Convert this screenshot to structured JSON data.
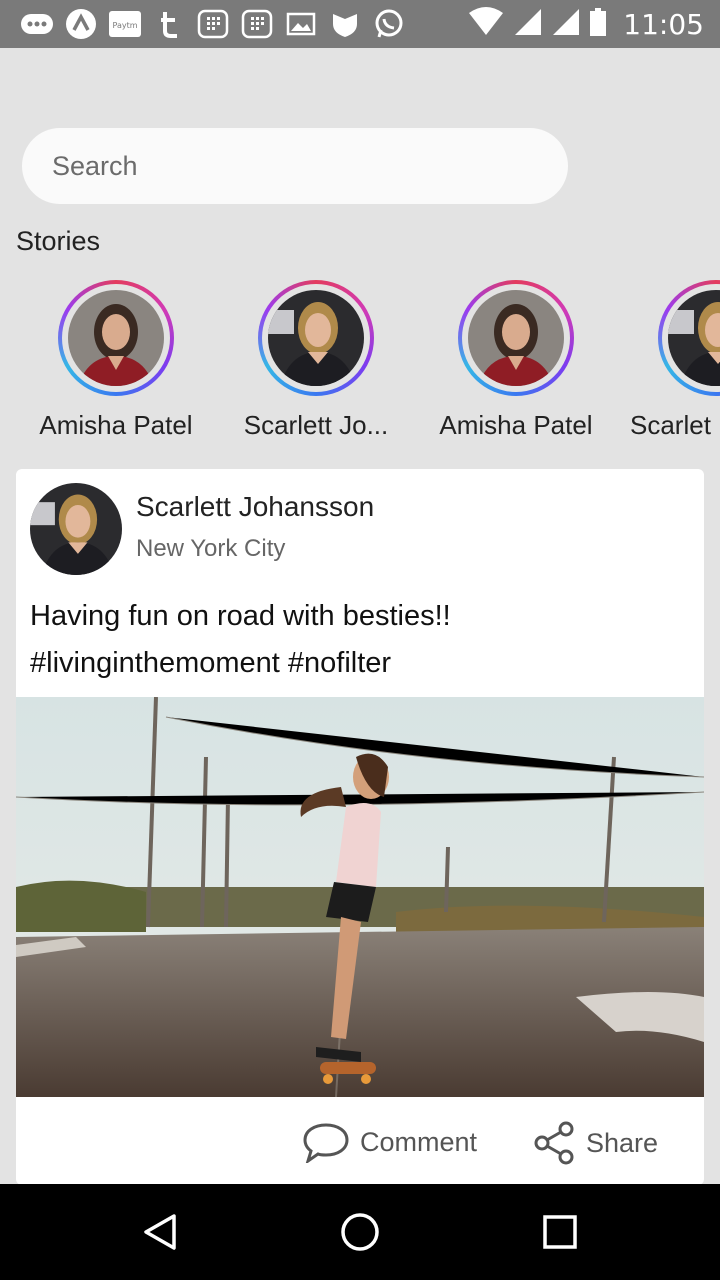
{
  "status_bar": {
    "time": "11:05",
    "left_icons": [
      "more-icon",
      "app-a-icon",
      "paytm-icon",
      "tumblr-icon",
      "calculator-icon",
      "calculator-icon",
      "image-icon",
      "shield-icon",
      "whatsapp-icon"
    ],
    "right_icons": [
      "wifi-icon",
      "signal-icon",
      "signal-icon",
      "battery-icon"
    ],
    "paytm_text": "Paytm"
  },
  "search": {
    "placeholder": "Search"
  },
  "stories": {
    "title": "Stories",
    "items": [
      {
        "name": "Amisha Patel"
      },
      {
        "name": "Scarlett Jo..."
      },
      {
        "name": "Amisha Patel"
      },
      {
        "name": "Scarlet"
      }
    ]
  },
  "post": {
    "author": "Scarlett Johansson",
    "location": "New York City",
    "text_line1": "Having fun on road with besties!!",
    "text_line2": "#livinginthemoment #nofilter",
    "actions": {
      "comment": "Comment",
      "share": "Share"
    }
  },
  "colors": {
    "background": "#e3e3e3",
    "status_bar": "#7a7a7a",
    "nav_bar": "#000000",
    "card": "#ffffff"
  }
}
